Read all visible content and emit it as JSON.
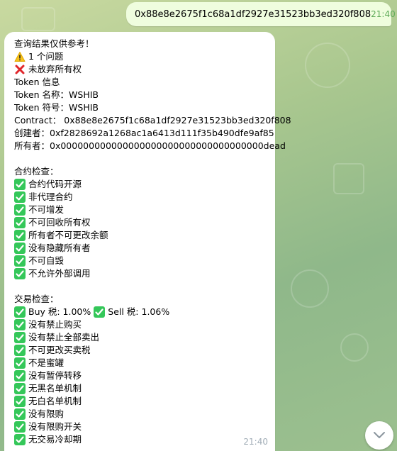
{
  "outgoing": {
    "text": "0x88e8e2675f1c68a1df2927e31523bb3ed320f808",
    "time": "21:40"
  },
  "incoming": {
    "time": "21:40",
    "lines": [
      {
        "icon": null,
        "text": "查询结果仅供参考！"
      },
      {
        "icon": "warning-icon",
        "text": "1 个问题"
      },
      {
        "icon": "cross-icon",
        "text": "未放弃所有权"
      },
      {
        "icon": null,
        "text": "Token 信息"
      },
      {
        "icon": null,
        "text": "Token 名称：WSHIB"
      },
      {
        "icon": null,
        "text": "Token 符号：WSHIB"
      },
      {
        "icon": null,
        "text": "Contract：  0x88e8e2675f1c68a1df2927e31523bb3ed320f808"
      },
      {
        "icon": null,
        "text": "创建者：0xf2828692a1268ac1a6413d111f35b490dfe9af85"
      },
      {
        "icon": null,
        "text": "所有者：0x000000000000000000000000000000000000dead"
      },
      {
        "icon": null,
        "text": ""
      },
      {
        "icon": null,
        "text": "合约检查："
      },
      {
        "icon": "check-icon",
        "text": "合约代码开源"
      },
      {
        "icon": "check-icon",
        "text": "非代理合约"
      },
      {
        "icon": "check-icon",
        "text": "不可增发"
      },
      {
        "icon": "check-icon",
        "text": "不可回收所有权"
      },
      {
        "icon": "check-icon",
        "text": "所有者不可更改余额"
      },
      {
        "icon": "check-icon",
        "text": "没有隐藏所有者"
      },
      {
        "icon": "check-icon",
        "text": "不可自毁"
      },
      {
        "icon": "check-icon",
        "text": "不允许外部调用"
      },
      {
        "icon": null,
        "text": ""
      },
      {
        "icon": null,
        "text": "交易检查："
      },
      {
        "icon": "check-icon",
        "text": "Buy 税: 1.00%",
        "icon2": "check-icon",
        "text2": "Sell 税: 1.06%"
      },
      {
        "icon": "check-icon",
        "text": "没有禁止购买"
      },
      {
        "icon": "check-icon",
        "text": "没有禁止全部卖出"
      },
      {
        "icon": "check-icon",
        "text": "不可更改买卖税"
      },
      {
        "icon": "check-icon",
        "text": "不是蜜罐"
      },
      {
        "icon": "check-icon",
        "text": "没有暂停转移"
      },
      {
        "icon": "check-icon",
        "text": "无黑名单机制"
      },
      {
        "icon": "check-icon",
        "text": "无白名单机制"
      },
      {
        "icon": "check-icon",
        "text": "没有限购"
      },
      {
        "icon": "check-icon",
        "text": "没有限购开关"
      },
      {
        "icon": "check-icon",
        "text": "无交易冷却期"
      }
    ]
  },
  "colors": {
    "outgoing_bubble": "#effdde",
    "incoming_bubble": "#ffffff",
    "check_green": "#34c759",
    "read_tick": "#5fab59"
  },
  "scroll_button": {
    "icon": "chevron-down-icon"
  }
}
